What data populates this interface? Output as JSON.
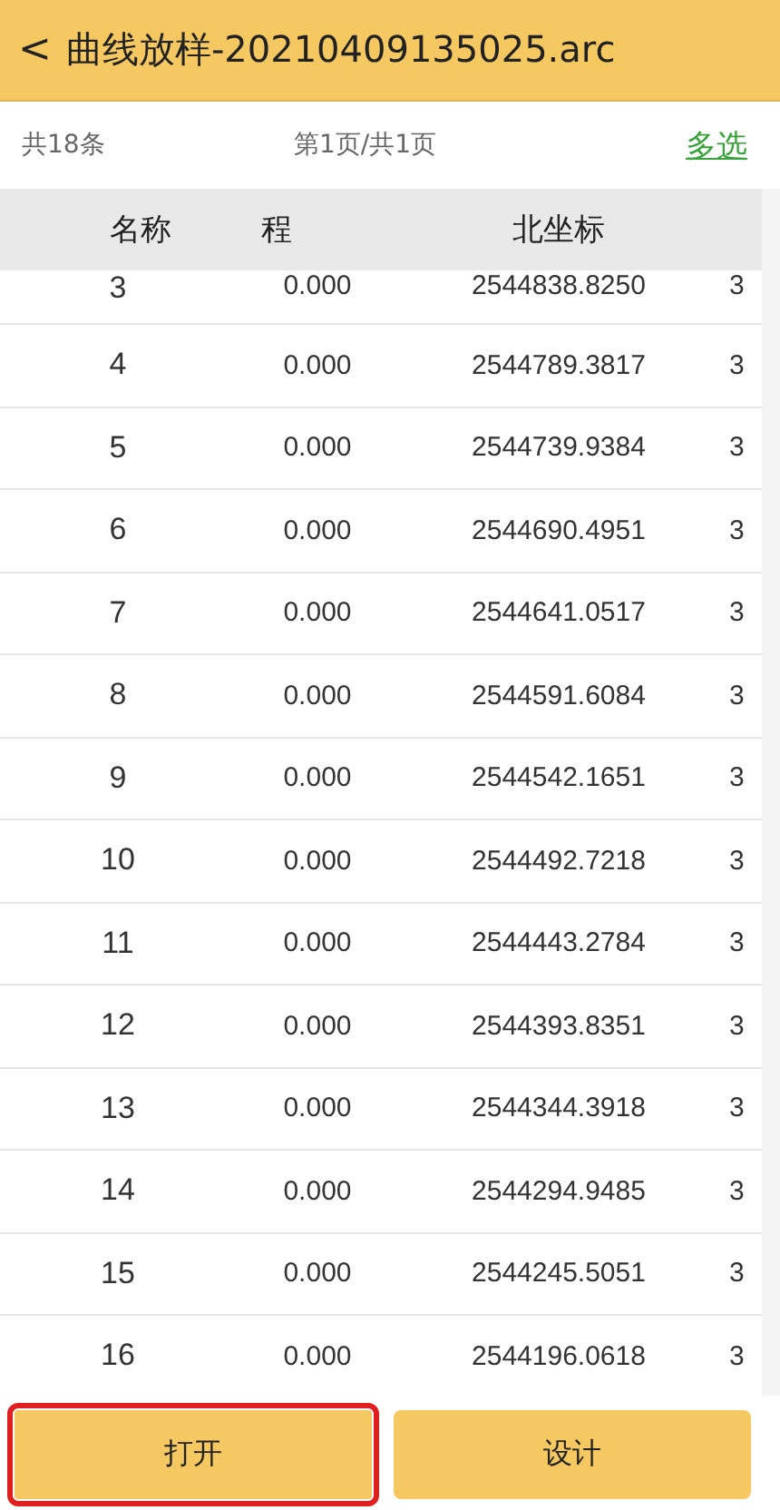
{
  "header": {
    "back_glyph": "<",
    "title": "曲线放样-20210409135025.arc"
  },
  "info_bar": {
    "total": "共18条",
    "page": "第1页/共1页",
    "multi_select": "多选"
  },
  "table": {
    "columns": [
      "名称",
      "程",
      "北坐标"
    ],
    "rows": [
      {
        "name": "3",
        "mileage": "0.000",
        "north": "2544838.8250",
        "column_4": "3"
      },
      {
        "name": "4",
        "mileage": "0.000",
        "north": "2544789.3817",
        "column_4": "3"
      },
      {
        "name": "5",
        "mileage": "0.000",
        "north": "2544739.9384",
        "column_4": "3"
      },
      {
        "name": "6",
        "mileage": "0.000",
        "north": "2544690.4951",
        "column_4": "3"
      },
      {
        "name": "7",
        "mileage": "0.000",
        "north": "2544641.0517",
        "column_4": "3"
      },
      {
        "name": "8",
        "mileage": "0.000",
        "north": "2544591.6084",
        "column_4": "3"
      },
      {
        "name": "9",
        "mileage": "0.000",
        "north": "2544542.1651",
        "column_4": "3"
      },
      {
        "name": "10",
        "mileage": "0.000",
        "north": "2544492.7218",
        "column_4": "3"
      },
      {
        "name": "11",
        "mileage": "0.000",
        "north": "2544443.2784",
        "column_4": "3"
      },
      {
        "name": "12",
        "mileage": "0.000",
        "north": "2544393.8351",
        "column_4": "3"
      },
      {
        "name": "13",
        "mileage": "0.000",
        "north": "2544344.3918",
        "column_4": "3"
      },
      {
        "name": "14",
        "mileage": "0.000",
        "north": "2544294.9485",
        "column_4": "3"
      },
      {
        "name": "15",
        "mileage": "0.000",
        "north": "2544245.5051",
        "column_4": "3"
      },
      {
        "name": "16",
        "mileage": "0.000",
        "north": "2544196.0618",
        "column_4": "3"
      }
    ]
  },
  "buttons": [
    {
      "label": "打开",
      "highlighted": true
    },
    {
      "label": "设计",
      "highlighted": false
    }
  ]
}
